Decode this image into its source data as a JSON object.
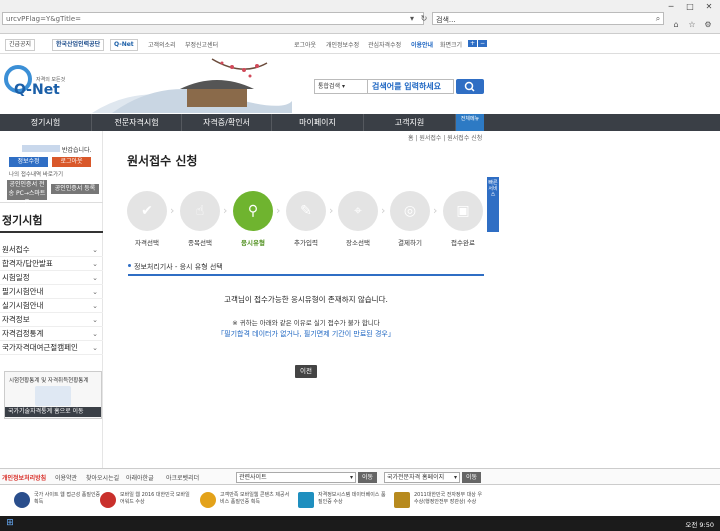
{
  "browser": {
    "address": "urcvPFlag=Y&gTitle=",
    "search_placeholder": "검색..."
  },
  "util": {
    "emergency": "긴급공지",
    "hrdk": "한국산업인력공단",
    "qnet_small": "Q-Net",
    "customer_voice": "고객의소리",
    "report_center": "부정신고센터",
    "logout": "로그아웃",
    "personal_info": "개인정보수정",
    "qual_info": "관심자격수정",
    "usage_guide": "이용안내",
    "zoom": "화면크기"
  },
  "header": {
    "logo_main": "Q-Net",
    "logo_sub": "자격의 모든것",
    "search_scope": "통합검색",
    "search_placeholder": "검색어를 입력하세요"
  },
  "nav": {
    "items": [
      "정기시험",
      "전문자격시험",
      "자격증/확인서",
      "마이페이지",
      "고객지원"
    ],
    "all_menu": "전체메뉴"
  },
  "sidebar": {
    "greeting": "반갑습니다.",
    "edit_info": "정보수정",
    "logout": "로그아웃",
    "my_apply_link": "나의 접수내역 바로가기",
    "cert_login": "공인인증서 전송 PC→스마트폰",
    "cert_register": "공인인증서 등록",
    "title": "정기시험",
    "menu": [
      "원서접수",
      "합격자/답안발표",
      "시험일정",
      "필기시험안내",
      "실기시험안내",
      "자격정보",
      "자격검정통계",
      "국가자격대여근절캠페인"
    ],
    "stats_text": "시험현황통계 및 자격취득현황통계",
    "stats_link": "국가기술자격통계 홈으로 이동"
  },
  "main": {
    "breadcrumb": "홈 | 원서접수 | 원서접수 신청",
    "title": "원서접수 신청",
    "steps": [
      "자격선택",
      "종목선택",
      "응시유형",
      "추가입력",
      "장소선택",
      "결제하기",
      "접수완료"
    ],
    "active_step": 2,
    "progress_tab": "빠른 서비스",
    "section_heading": "정보처리기사 - 응시 유형 선택",
    "message_main": "고객님이 접수가능한 응시유형이 존재하지 않습니다.",
    "message_note": "※ 귀하는 아래와 같은 이유로 실기 접수가 불가 합니다",
    "message_reason": "「필기합격 데이터가 없거나, 필기면제 기간이 만료된 경우」",
    "prev_button": "이전"
  },
  "footer": {
    "privacy": "개인정보처리방침",
    "terms": "이용약관",
    "directions": "찾아오시는길",
    "english": "아래아한글",
    "acrobat": "아크로벳리더",
    "related_select": "관련사이트",
    "go1": "이동",
    "national_select": "국가전문자격 홈페이지",
    "go2": "이동",
    "awards": [
      "국가 사이트 웹 접근성 품질인증 획득",
      "모바일 웹 2016 대한민국 모바일어워드 수상",
      "고객만족 모바일웹 콘텐츠 제공서비스 품질인증 획득",
      "자격정보시스템 데이터베이스 품질인증 수상",
      "2011대한민국 전자정부 대상 우수상(행정안전부 장관상) 수상"
    ]
  },
  "taskbar": {
    "time": "오전 9:50"
  },
  "colors": {
    "nav": "#3a3f46",
    "accent": "#2f6ec4",
    "active_step": "#6fb42f"
  }
}
